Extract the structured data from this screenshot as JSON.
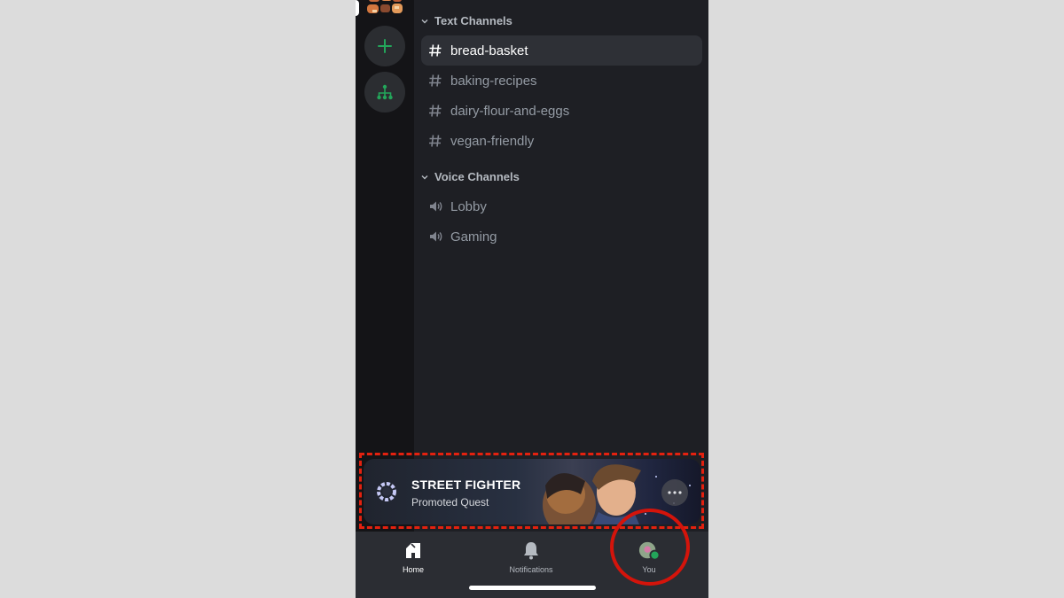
{
  "sidebar": {
    "add_server_label": "",
    "discover_label": ""
  },
  "categories": [
    {
      "name": "Text Channels",
      "channels": [
        {
          "name": "bread-basket",
          "type": "text",
          "active": true
        },
        {
          "name": "baking-recipes",
          "type": "text",
          "active": false
        },
        {
          "name": "dairy-flour-and-eggs",
          "type": "text",
          "active": false
        },
        {
          "name": "vegan-friendly",
          "type": "text",
          "active": false
        }
      ]
    },
    {
      "name": "Voice Channels",
      "channels": [
        {
          "name": "Lobby",
          "type": "voice",
          "active": false
        },
        {
          "name": "Gaming",
          "type": "voice",
          "active": false
        }
      ]
    }
  ],
  "promo": {
    "title": "STREET FIGHTER",
    "subtitle": "Promoted Quest",
    "more_icon": "ellipsis-icon"
  },
  "bottom_nav": [
    {
      "label": "Home",
      "icon": "home-icon",
      "active": true
    },
    {
      "label": "Notifications",
      "icon": "bell-icon",
      "active": false
    },
    {
      "label": "You",
      "icon": "avatar-icon",
      "active": false
    }
  ],
  "colors": {
    "accent_green": "#23a55a",
    "highlight_red": "#d4140b",
    "background": "#1e1f24"
  }
}
